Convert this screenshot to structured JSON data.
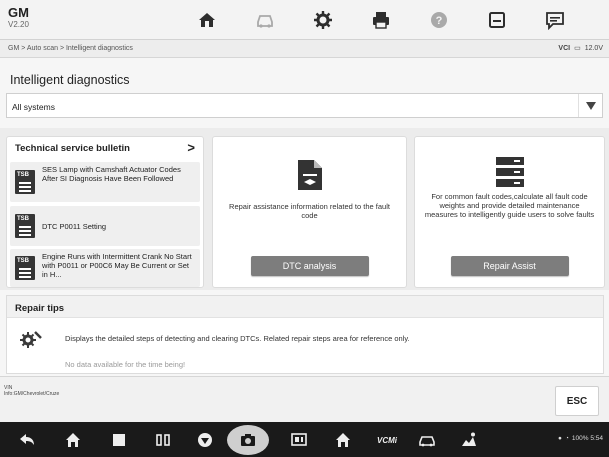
{
  "header": {
    "brand": "GM",
    "version": "V2.20",
    "toolbar": [
      {
        "icon": "home-icon",
        "state": "normal"
      },
      {
        "icon": "vehicle-icon",
        "state": "dim"
      },
      {
        "icon": "settings-icon",
        "state": "normal"
      },
      {
        "icon": "print-icon",
        "state": "normal"
      },
      {
        "icon": "help-icon",
        "state": "dim"
      },
      {
        "icon": "save-icon",
        "state": "normal"
      },
      {
        "icon": "message-icon",
        "state": "normal"
      }
    ]
  },
  "breadcrumb": "GM > Auto scan > Intelligent diagnostics",
  "status": {
    "vci": "VCI ",
    "battery_voltage": "12.0V"
  },
  "page": {
    "title": "Intelligent diagnostics",
    "system_select": "All systems"
  },
  "tsb": {
    "title": "Technical service bulletin",
    "chevron": ">",
    "icon_label": "TSB",
    "items": [
      {
        "text": "SES Lamp with Camshaft Actuator Codes After SI Diagnosis Have Been Followed"
      },
      {
        "text": "DTC P0011 Setting"
      },
      {
        "text": "Engine Runs with Intermittent Crank No Start with P0011 or P00C6 May Be Current or Set in H..."
      }
    ]
  },
  "dtc_card": {
    "description": "Repair assistance information related to the fault code",
    "button": "DTC analysis"
  },
  "repair_card": {
    "description": "For common fault codes,calculate all fault code weights and provide detailed maintenance measures to intelligently guide users to solve faults",
    "button": "Repair Assist"
  },
  "repair_tips": {
    "title": "Repair tips",
    "text": "Displays the detailed steps of detecting and clearing DTCs. Related repair steps area for reference only.",
    "no_data": "No data available for the time being!"
  },
  "footer": {
    "vin_label": "VIN",
    "vehicle_info": "Info:GM/Chevrolet/Cruze",
    "esc": "ESC"
  },
  "navbar": {
    "vcmi_label": "VCMi",
    "status_text": "100% 5:54",
    "colors": {
      "nav_bg": "#1a1a1a",
      "button_gray": "#7d7d7d"
    }
  }
}
